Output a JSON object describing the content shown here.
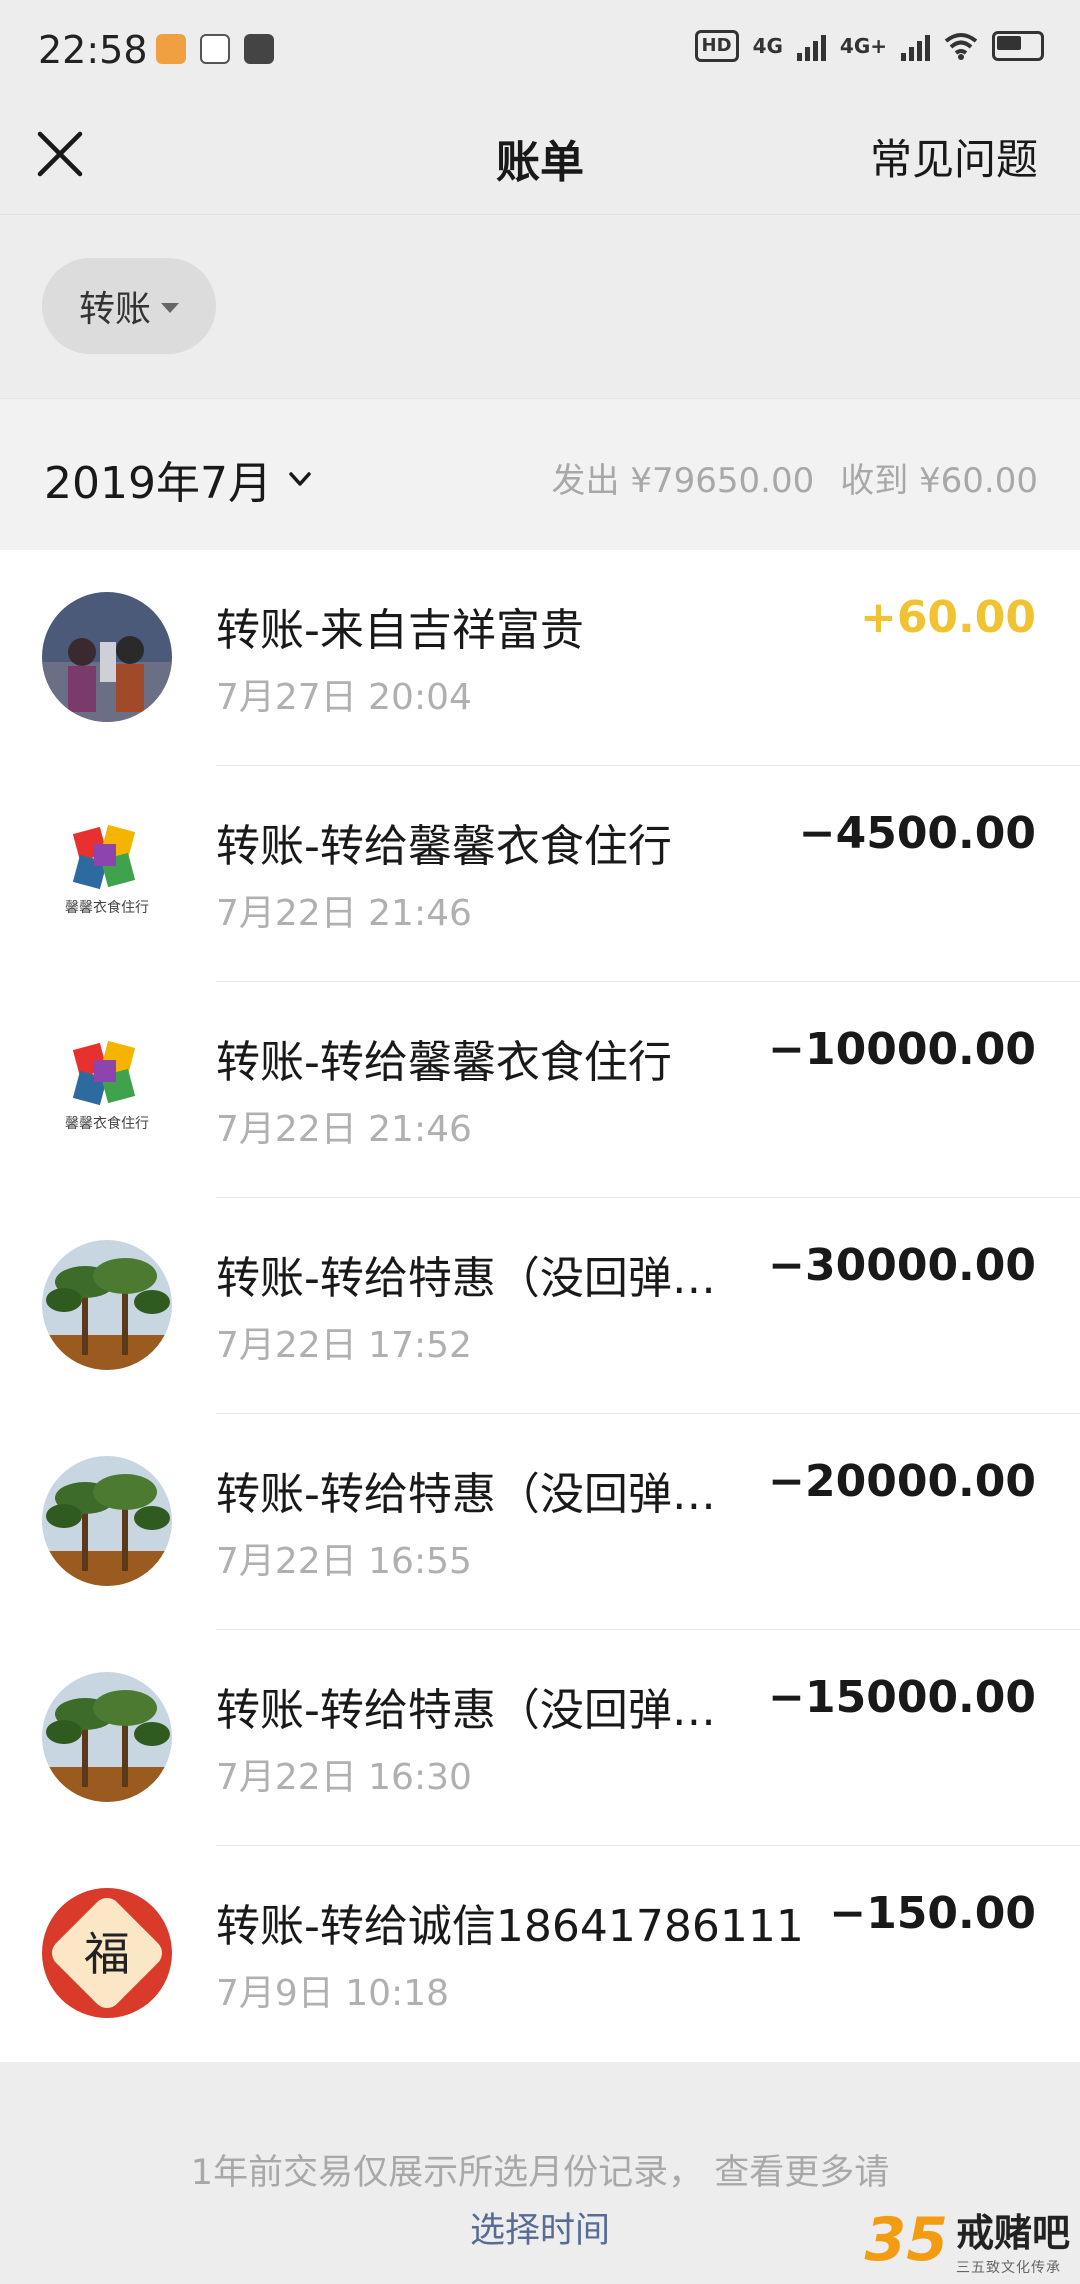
{
  "status_bar": {
    "time": "22:58",
    "hd_label": "HD",
    "net1": "4G",
    "net2": "4G+"
  },
  "nav": {
    "title": "账单",
    "faq_label": "常见问题"
  },
  "filter": {
    "chip_label": "转账"
  },
  "month": {
    "label": "2019年7月",
    "out_text": "发出 ¥79650.00",
    "in_text": "收到 ¥60.00"
  },
  "transactions": [
    {
      "title": "转账-来自吉祥富贵",
      "time": "7月27日 20:04",
      "amount": "+60.00",
      "avatar": "photo-avatar-people"
    },
    {
      "title": "转账-转给馨馨衣食住行",
      "time": "7月22日 21:46",
      "amount": "−4500.00",
      "avatar": "logo-avatar-xinxin"
    },
    {
      "title": "转账-转给馨馨衣食住行",
      "time": "7月22日 21:46",
      "amount": "−10000.00",
      "avatar": "logo-avatar-xinxin"
    },
    {
      "title": "转账-转给特惠（没回弹…",
      "time": "7月22日 17:52",
      "amount": "−30000.00",
      "avatar": "photo-avatar-palm-trees"
    },
    {
      "title": "转账-转给特惠（没回弹…",
      "time": "7月22日 16:55",
      "amount": "−20000.00",
      "avatar": "photo-avatar-palm-trees"
    },
    {
      "title": "转账-转给特惠（没回弹…",
      "time": "7月22日 16:30",
      "amount": "−15000.00",
      "avatar": "photo-avatar-palm-trees"
    },
    {
      "title": "转账-转给诚信18641786111",
      "time": "7月9日 10:18",
      "amount": "−150.00",
      "avatar": "fu-avatar"
    }
  ],
  "avatar_texts": {
    "xinxin_logo": "馨馨衣食住行",
    "fu": "福"
  },
  "footer": {
    "note": "1年前交易仅展示所选月份记录， 查看更多请",
    "link": "选择时间"
  },
  "watermark": {
    "number": "35",
    "name": "戒赌吧",
    "sub": "三五致文化传承"
  },
  "colors": {
    "income": "#f1c232",
    "link": "#576b95",
    "background": "#ededed"
  }
}
